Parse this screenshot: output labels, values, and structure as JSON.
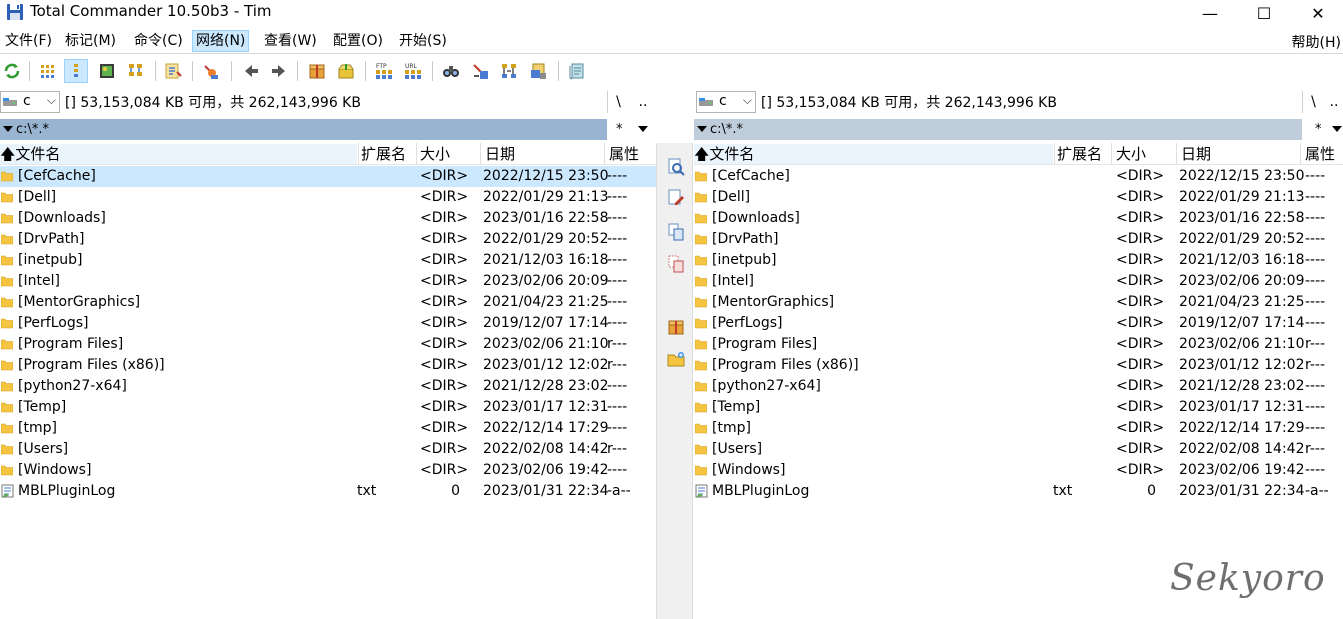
{
  "window": {
    "title": "Total Commander 10.50b3 - Tim",
    "minimize": "—",
    "maximize": "☐",
    "close": "✕"
  },
  "menu": [
    {
      "label": "文件(F)"
    },
    {
      "label": "标记(M)"
    },
    {
      "label": "命令(C)"
    },
    {
      "label": "网络(N)",
      "active": true
    },
    {
      "label": "查看(W)"
    },
    {
      "label": "配置(O)"
    },
    {
      "label": "开始(S)"
    }
  ],
  "help_label": "帮助(H)",
  "toolbar_icons": [
    "refresh-icon",
    "brief-view-icon",
    "detailed-view-icon",
    "thumbnail-view-icon",
    "tree-view-icon",
    "invert-selection-icon",
    "compare-dirs-icon",
    "back-icon",
    "forward-icon",
    "pack-icon",
    "unpack-icon",
    "ftp-connect-icon",
    "url-ftp-icon",
    "find-files-icon",
    "multi-rename-icon",
    "sync-dirs-icon",
    "copy-names-icon",
    "notepad-icon"
  ],
  "left": {
    "drive": "c",
    "drive_info": "[]  53,153,084 KB 可用，共 262,143,996 KB",
    "root_btn": "\\",
    "up_btn": "..",
    "path": "c:\\*.*",
    "filter": "*"
  },
  "right": {
    "drive": "c",
    "drive_info": "[]  53,153,084 KB 可用，共 262,143,996 KB",
    "root_btn": "\\",
    "up_btn": "..",
    "path": "c:\\*.*",
    "filter": "*"
  },
  "columns": {
    "name": "文件名",
    "ext": "扩展名",
    "size": "大小",
    "date": "日期",
    "attr": "属性"
  },
  "files": [
    {
      "name": "[CefCache]",
      "ext": "",
      "size": "<DIR>",
      "date": "2022/12/15 23:50",
      "attr": "----",
      "type": "dir"
    },
    {
      "name": "[Dell]",
      "ext": "",
      "size": "<DIR>",
      "date": "2022/01/29 21:13",
      "attr": "----",
      "type": "dir"
    },
    {
      "name": "[Downloads]",
      "ext": "",
      "size": "<DIR>",
      "date": "2023/01/16 22:58",
      "attr": "----",
      "type": "dir"
    },
    {
      "name": "[DrvPath]",
      "ext": "",
      "size": "<DIR>",
      "date": "2022/01/29 20:52",
      "attr": "----",
      "type": "dir"
    },
    {
      "name": "[inetpub]",
      "ext": "",
      "size": "<DIR>",
      "date": "2021/12/03 16:18",
      "attr": "----",
      "type": "dir"
    },
    {
      "name": "[Intel]",
      "ext": "",
      "size": "<DIR>",
      "date": "2023/02/06 20:09",
      "attr": "----",
      "type": "dir"
    },
    {
      "name": "[MentorGraphics]",
      "ext": "",
      "size": "<DIR>",
      "date": "2021/04/23 21:25",
      "attr": "----",
      "type": "dir"
    },
    {
      "name": "[PerfLogs]",
      "ext": "",
      "size": "<DIR>",
      "date": "2019/12/07 17:14",
      "attr": "----",
      "type": "dir"
    },
    {
      "name": "[Program Files]",
      "ext": "",
      "size": "<DIR>",
      "date": "2023/02/06 21:10",
      "attr": "r---",
      "type": "dir"
    },
    {
      "name": "[Program Files (x86)]",
      "ext": "",
      "size": "<DIR>",
      "date": "2023/01/12 12:02",
      "attr": "r---",
      "type": "dir"
    },
    {
      "name": "[python27-x64]",
      "ext": "",
      "size": "<DIR>",
      "date": "2021/12/28 23:02",
      "attr": "----",
      "type": "dir"
    },
    {
      "name": "[Temp]",
      "ext": "",
      "size": "<DIR>",
      "date": "2023/01/17 12:31",
      "attr": "----",
      "type": "dir"
    },
    {
      "name": "[tmp]",
      "ext": "",
      "size": "<DIR>",
      "date": "2022/12/14 17:29",
      "attr": "----",
      "type": "dir"
    },
    {
      "name": "[Users]",
      "ext": "",
      "size": "<DIR>",
      "date": "2022/02/08 14:42",
      "attr": "r---",
      "type": "dir"
    },
    {
      "name": "[Windows]",
      "ext": "",
      "size": "<DIR>",
      "date": "2023/02/06 19:42",
      "attr": "----",
      "type": "dir"
    },
    {
      "name": "MBLPluginLog",
      "ext": "txt",
      "size": "0",
      "date": "2023/01/31 22:34",
      "attr": "-a--",
      "type": "file"
    }
  ],
  "left_selected_index": 0,
  "middle_buttons": [
    "view-file-icon",
    "edit-file-icon",
    "copy-file-icon",
    "move-file-icon",
    "pack-files-icon",
    "new-folder-icon"
  ],
  "watermark": "Sekyoro",
  "colors": {
    "active_path_bg": "#99b4d1",
    "inactive_path_bg": "#bfcddb",
    "selection": "#cce8ff",
    "folder": "#f5c542"
  }
}
